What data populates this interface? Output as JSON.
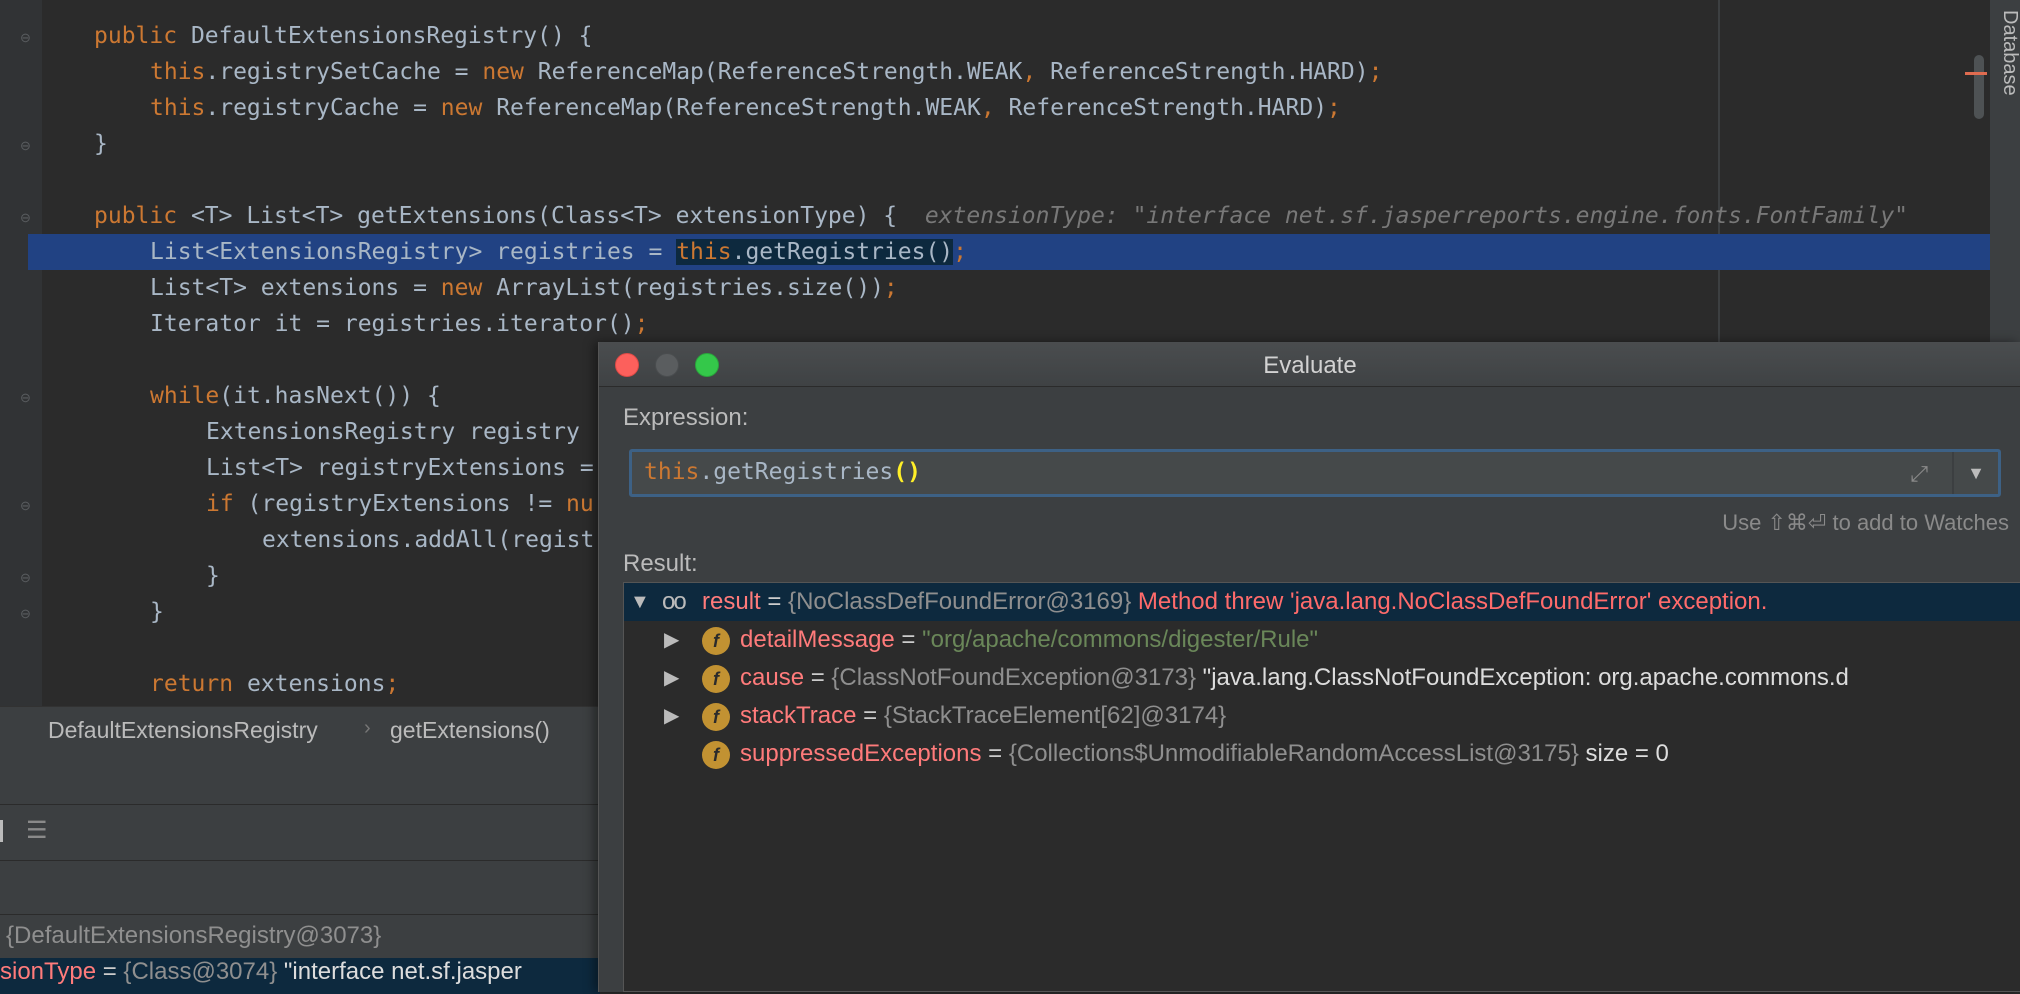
{
  "editor": {
    "lines": {
      "l1": {
        "kw": "public",
        "rest": " DefaultExtensionsRegistry() {"
      },
      "l2": {
        "kw1": "this",
        "a": ".registrySetCache = ",
        "kw2": "new",
        "b": " ReferenceMap(ReferenceStrength.WEAK",
        "c1": ",",
        "c": " ReferenceStrength.HARD)",
        "semi": ";"
      },
      "l3": {
        "kw1": "this",
        "a": ".registryCache = ",
        "kw2": "new",
        "b": " ReferenceMap(ReferenceStrength.WEAK",
        "c1": ",",
        "c": " ReferenceStrength.HARD)",
        "semi": ";"
      },
      "l4": "}",
      "l5": {
        "kw": "public",
        "rest": " <T> List<T> getExtensions(Class<T> extensionType) {",
        "hint": "extensionType: \"interface net.sf.jasperreports.engine.fonts.FontFamily\""
      },
      "l6": {
        "a": "List<ExtensionsRegistry> registries = ",
        "kw": "this",
        "b": ".getRegistries()",
        "semi": ";"
      },
      "l7": {
        "a": "List<T> extensions = ",
        "kw": "new",
        "b": " ArrayList(registries.size())",
        "semi": ";"
      },
      "l8": {
        "a": "Iterator it = registries.iterator()",
        "semi": ";"
      },
      "l9": {
        "kw": "while",
        "rest": "(it.hasNext()) {"
      },
      "l10": "ExtensionsRegistry registry ",
      "l11": "List<T> registryExtensions = ",
      "l12": {
        "kw": "if",
        "rest": " (registryExtensions != ",
        "kw2": "nu"
      },
      "l13": "extensions.addAll(regist",
      "l14": "}",
      "l15": "}",
      "l16": {
        "kw": "return",
        "rest": " extensions",
        "semi": ";"
      }
    },
    "side_tab": "Database"
  },
  "breadcrumb": {
    "class_name": "DefaultExtensionsRegistry",
    "separator": "›",
    "method_name": "getExtensions()"
  },
  "debug_panel": {
    "this_value": "{DefaultExtensionsRegistry@3073}",
    "var_name": "sionType",
    "var_eq": " = ",
    "var_ref": "{Class@3074}",
    "var_value": " \"interface net.sf.jasper"
  },
  "dialog": {
    "title": "Evaluate",
    "expression_label": "Expression:",
    "expression": {
      "kw": "this",
      "rest": ".getRegistries",
      "parens": "()"
    },
    "watches_hint": "Use ⇧⌘⏎ to add to Watches",
    "result_label": "Result:",
    "result": {
      "name": "result",
      "eq": " = ",
      "ref": "{NoClassDefFoundError@3169}",
      "message": " Method threw 'java.lang.NoClassDefFoundError' exception.",
      "children": [
        {
          "name": "detailMessage",
          "eq": " = ",
          "value": "\"org/apache/commons/digester/Rule\"",
          "expandable": true
        },
        {
          "name": "cause",
          "eq": " = ",
          "ref": "{ClassNotFoundException@3173}",
          "value": " \"java.lang.ClassNotFoundException: org.apache.commons.d",
          "expandable": true
        },
        {
          "name": "stackTrace",
          "eq": " = ",
          "ref": "{StackTraceElement[62]@3174}",
          "expandable": true
        },
        {
          "name": "suppressedExceptions",
          "eq": " = ",
          "ref": "{Collections$UnmodifiableRandomAccessList@3175}",
          "value": "  size = 0",
          "expandable": false
        }
      ]
    }
  },
  "icons": {
    "expand": "⤢",
    "dropdown": "▼",
    "tree_expanded": "▼",
    "tree_collapsed": "▶",
    "field_badge": "f",
    "watch": "oo",
    "toggle_settings": "☰"
  },
  "colors": {
    "keyword": "#cc7832",
    "selection": "#214283",
    "error": "#ff6b6b",
    "string": "#6a8759",
    "field_badge": "#c29232"
  }
}
